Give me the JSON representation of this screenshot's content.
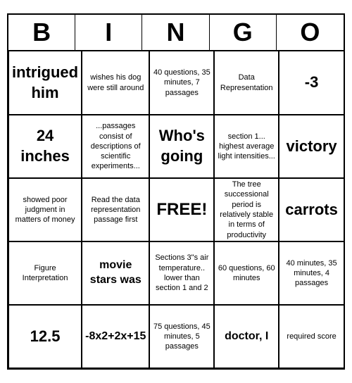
{
  "header": {
    "letters": [
      "B",
      "I",
      "N",
      "G",
      "O"
    ]
  },
  "cells": [
    {
      "text": "intrigued him",
      "size": "large"
    },
    {
      "text": "wishes his dog were still around",
      "size": "small"
    },
    {
      "text": "40 questions, 35 minutes, 7 passages",
      "size": "small"
    },
    {
      "text": "Data Representation",
      "size": "small"
    },
    {
      "text": "-3",
      "size": "large"
    },
    {
      "text": "24 inches",
      "size": "large"
    },
    {
      "text": "...passages consist of descriptions of scientific experiments...",
      "size": "small"
    },
    {
      "text": "Who's going",
      "size": "large"
    },
    {
      "text": "section 1... highest average light intensities...",
      "size": "small"
    },
    {
      "text": "victory",
      "size": "large"
    },
    {
      "text": "showed poor judgment in matters of money",
      "size": "small"
    },
    {
      "text": "Read the data representation passage first",
      "size": "small"
    },
    {
      "text": "FREE!",
      "size": "free"
    },
    {
      "text": "The tree successional period is relatively stable in terms of productivity",
      "size": "small"
    },
    {
      "text": "carrots",
      "size": "large"
    },
    {
      "text": "Figure Interpretation",
      "size": "small"
    },
    {
      "text": "movie stars was",
      "size": "medium"
    },
    {
      "text": "Sections 3\"s air temperature.. lower than section 1 and 2",
      "size": "small"
    },
    {
      "text": "60 questions, 60 minutes",
      "size": "small"
    },
    {
      "text": "40 minutes, 35 minutes, 4 passages",
      "size": "small"
    },
    {
      "text": "12.5",
      "size": "large"
    },
    {
      "text": "-8x2+2x+15",
      "size": "medium"
    },
    {
      "text": "75 questions, 45 minutes, 5 passages",
      "size": "small"
    },
    {
      "text": "doctor, I",
      "size": "medium"
    },
    {
      "text": "required score",
      "size": "small"
    }
  ]
}
